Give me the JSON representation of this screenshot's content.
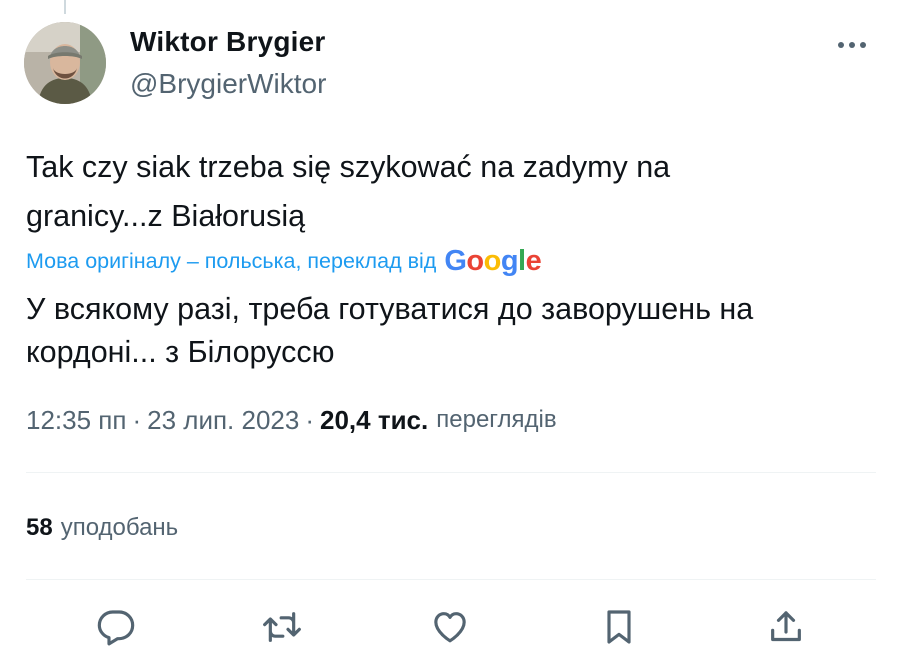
{
  "author": {
    "name": "Wiktor Brygier",
    "handle": "@BrygierWiktor"
  },
  "tweet": {
    "text": "Tak czy siak trzeba się szykować na zadymy na\ngranicy...z Białorusią",
    "translation_note": "Мова оригіналу – польська, переклад від",
    "translation_provider": [
      "G",
      "o",
      "o",
      "g",
      "l",
      "e"
    ],
    "translated_text": "У всякому разі, треба готуватися до заворушень на\nкордоні... з Білоруссю"
  },
  "meta": {
    "time": "12:35 пп",
    "separator": "·",
    "date": "23 лип. 2023",
    "views_count": "20,4 тис.",
    "views_label": "переглядів"
  },
  "stats": {
    "likes_count": "58",
    "likes_label": "уподобань"
  },
  "actions": {
    "icons": [
      "reply-icon",
      "retweet-icon",
      "like-icon",
      "bookmark-icon",
      "share-icon"
    ]
  },
  "colors": {
    "text_primary": "#0f1419",
    "text_secondary": "#536471",
    "link_blue": "#1d9bf0",
    "divider": "#eff3f4",
    "google_blue": "#4285F4",
    "google_red": "#EA4335",
    "google_yellow": "#FBBC05",
    "google_green": "#34A853"
  }
}
